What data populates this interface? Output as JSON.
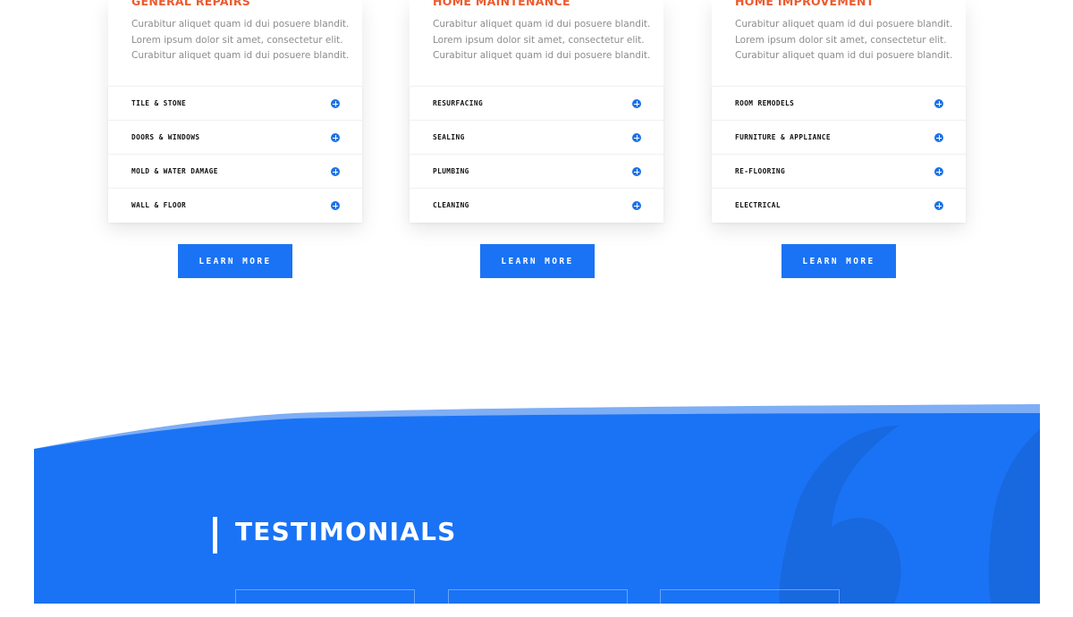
{
  "services": [
    {
      "title": "General Repairs",
      "description": [
        "Curabitur aliquet quam id dui posuere blandit.",
        "Lorem ipsum dolor sit amet, consectetur elit.",
        "Curabitur aliquet quam id dui posuere blandit."
      ],
      "items": [
        "Tile & Stone",
        "Doors & Windows",
        "Mold & Water Damage",
        "Wall & Floor"
      ],
      "button_label": "Learn More"
    },
    {
      "title": "Home Maintenance",
      "description": [
        "Curabitur aliquet quam id dui posuere blandit.",
        "Lorem ipsum dolor sit amet, consectetur elit.",
        "Curabitur aliquet quam id dui posuere blandit."
      ],
      "items": [
        "Resurfacing",
        "Sealing",
        "Plumbing",
        "Cleaning"
      ],
      "button_label": "Learn More"
    },
    {
      "title": "Home Improvement",
      "description": [
        "Curabitur aliquet quam id dui posuere blandit.",
        "Lorem ipsum dolor sit amet, consectetur elit.",
        "Curabitur aliquet quam id dui posuere blandit."
      ],
      "items": [
        "Room Remodels",
        "Furniture & Appliance",
        "Re-Flooring",
        "Electrical"
      ],
      "button_label": "Learn More"
    }
  ],
  "item_icon": "plus-circle-icon",
  "testimonials": {
    "heading": "Testimonials",
    "decoration_icon": "quote-mark-icon"
  },
  "colors": {
    "accent_blue": "#1a73f5",
    "title_orange": "#ec5a2e",
    "section_blue": "#1a73f5",
    "wave_light_blue": "#7eaef5"
  }
}
